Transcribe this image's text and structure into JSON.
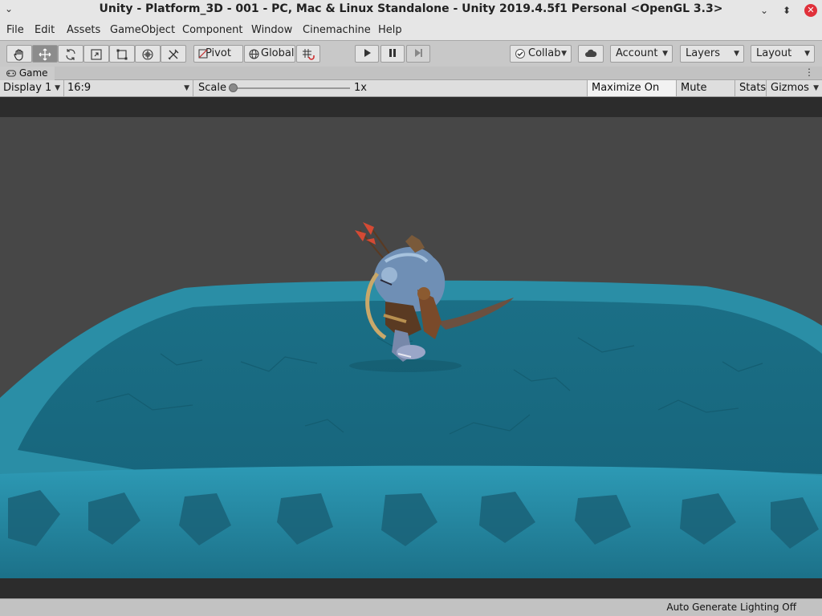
{
  "window": {
    "title": "Unity - Platform_3D - 001 - PC, Mac & Linux Standalone - Unity 2019.4.5f1 Personal <OpenGL 3.3>"
  },
  "menu": [
    "File",
    "Edit",
    "Assets",
    "GameObject",
    "Component",
    "Window",
    "Cinemachine",
    "Help"
  ],
  "toolbar": {
    "tools": [
      "hand-tool",
      "move-tool",
      "rotate-tool",
      "scale-tool",
      "rect-tool",
      "transform-tool",
      "custom-tool"
    ],
    "active_tool": "move-tool",
    "pivot_label": "Pivot",
    "global_label": "Global",
    "collab_label": "Collab",
    "account_label": "Account",
    "layers_label": "Layers",
    "layout_label": "Layout"
  },
  "tab": {
    "game_label": "Game"
  },
  "gameview": {
    "display_label": "Display 1",
    "aspect_label": "16:9",
    "scale_label": "Scale",
    "scale_value": "1x",
    "scale_slider_fraction": 0.0,
    "maximize_label": "Maximize On Play",
    "mute_label": "Mute Audio",
    "stats_label": "Stats",
    "gizmos_label": "Gizmos"
  },
  "status": {
    "text": "Auto Generate Lighting Off"
  },
  "colors": {
    "sky": "#474747",
    "platform_top": "#1e7890",
    "platform_edge": "#2a8fa8",
    "letterbox": "#2c2c2c"
  }
}
